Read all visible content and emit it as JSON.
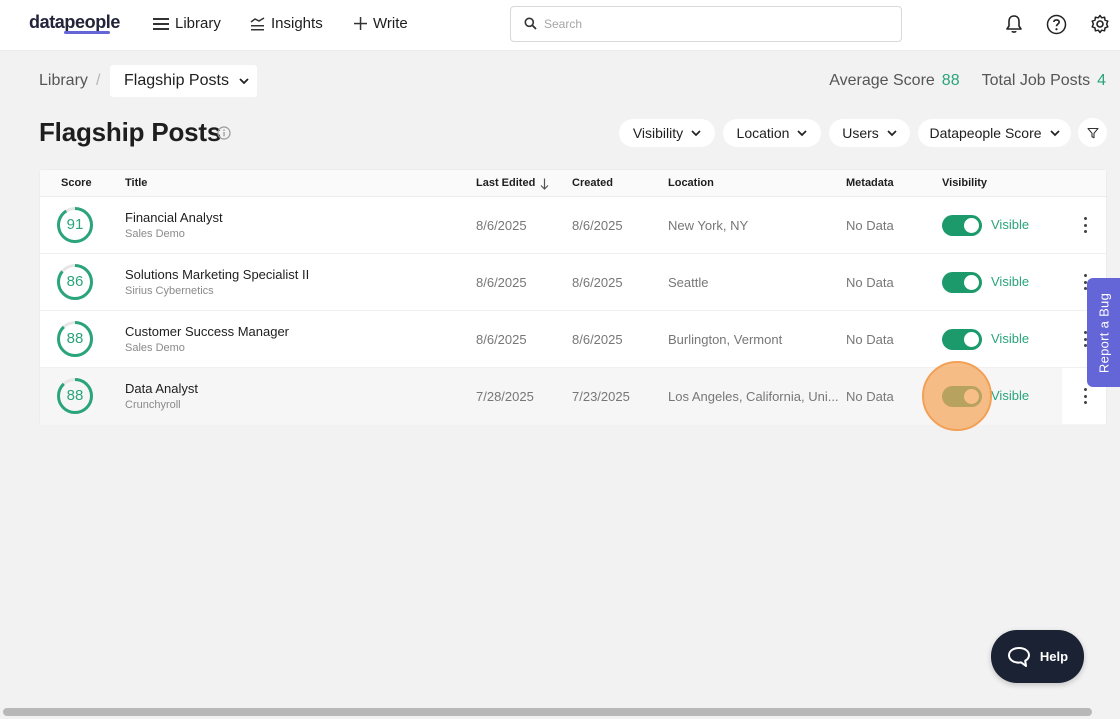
{
  "nav": {
    "logo": "datapeople",
    "items": [
      {
        "label": "Library",
        "icon": "menu-icon"
      },
      {
        "label": "Insights",
        "icon": "insights-icon"
      },
      {
        "label": "Write",
        "icon": "plus-icon"
      }
    ],
    "search_placeholder": "Search",
    "icons": [
      "bell-icon",
      "help-circle-icon",
      "gear-icon"
    ]
  },
  "breadcrumb": {
    "root": "Library",
    "separator": "/",
    "current": "Flagship Posts"
  },
  "stats": {
    "average_label": "Average Score",
    "average_value": "88",
    "total_label": "Total Job Posts",
    "total_value": "4"
  },
  "page": {
    "title": "Flagship Posts",
    "filters": [
      "Visibility",
      "Location",
      "Users",
      "Datapeople Score"
    ]
  },
  "table": {
    "headers": {
      "score": "Score",
      "title": "Title",
      "last_edited": "Last Edited",
      "created": "Created",
      "location": "Location",
      "metadata": "Metadata",
      "visibility": "Visibility"
    },
    "rows": [
      {
        "score": "91",
        "score_fraction": 0.91,
        "title": "Financial Analyst",
        "company": "Sales Demo",
        "last_edited": "8/6/2025",
        "created": "8/6/2025",
        "location": "New York, NY",
        "metadata": "No Data",
        "visibility": "Visible",
        "visible": true
      },
      {
        "score": "86",
        "score_fraction": 0.86,
        "title": "Solutions Marketing Specialist II",
        "company": "Sirius Cybernetics",
        "last_edited": "8/6/2025",
        "created": "8/6/2025",
        "location": "Seattle",
        "metadata": "No Data",
        "visibility": "Visible",
        "visible": true
      },
      {
        "score": "88",
        "score_fraction": 0.88,
        "title": "Customer Success Manager",
        "company": "Sales Demo",
        "last_edited": "8/6/2025",
        "created": "8/6/2025",
        "location": "Burlington, Vermont",
        "metadata": "No Data",
        "visibility": "Visible",
        "visible": true
      },
      {
        "score": "88",
        "score_fraction": 0.88,
        "title": "Data Analyst",
        "company": "Crunchyroll",
        "last_edited": "7/28/2025",
        "created": "7/23/2025",
        "location": "Los Angeles, California, Uni...",
        "metadata": "No Data",
        "visibility": "Visible",
        "visible": true
      }
    ]
  },
  "report_bug": "Report a Bug",
  "help": "Help",
  "colors": {
    "accent": "#2aa47a",
    "toggle_on": "#1c9a6c",
    "brand": "#6466d8",
    "help_bg": "#1a2233"
  }
}
